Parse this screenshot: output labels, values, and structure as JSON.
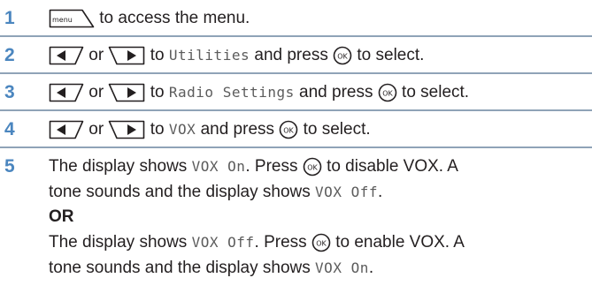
{
  "steps": [
    {
      "number": "1",
      "text_a": "to access the menu.",
      "icons": [
        "menu-key-icon"
      ]
    },
    {
      "number": "2",
      "word_or": "or",
      "word_to": "to",
      "menu_item": "Utilities",
      "text_b": "and press",
      "text_c": "to select.",
      "icons": [
        "left-arrow-key-icon",
        "right-arrow-key-icon",
        "ok-key-icon"
      ]
    },
    {
      "number": "3",
      "word_or": "or",
      "word_to": "to",
      "menu_item": "Radio Settings",
      "text_b": "and press",
      "text_c": "to select.",
      "icons": [
        "left-arrow-key-icon",
        "right-arrow-key-icon",
        "ok-key-icon"
      ]
    },
    {
      "number": "4",
      "word_or": "or",
      "word_to": "to",
      "menu_item": "VOX",
      "text_b": "and press",
      "text_c": "to select.",
      "icons": [
        "left-arrow-key-icon",
        "right-arrow-key-icon",
        "ok-key-icon"
      ]
    },
    {
      "number": "5",
      "l1_a": "The display shows",
      "l1_mono": "VOX On",
      "l1_b": ". Press",
      "l1_c": "to disable VOX. A",
      "l2_a": "tone sounds and the display shows",
      "l2_mono": "VOX Off",
      "l2_b": ".",
      "or_label": "OR",
      "l4_a": "The display shows",
      "l4_mono": "VOX Off",
      "l4_b": ". Press",
      "l4_c": "to enable VOX. A",
      "l5_a": "tone sounds and the display shows",
      "l5_mono": "VOX On",
      "l5_b": "."
    }
  ],
  "key_labels": {
    "menu": "menu",
    "ok": "OK"
  }
}
